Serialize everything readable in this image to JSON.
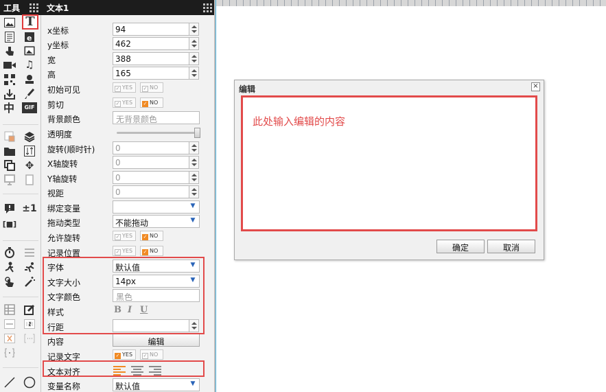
{
  "tools": {
    "title": "工具",
    "items": [
      {
        "name": "image-icon"
      },
      {
        "name": "text-icon",
        "glyph": "T"
      },
      {
        "name": "document-icon"
      },
      {
        "name": "text-box-icon"
      },
      {
        "name": "hand-pointer-icon"
      },
      {
        "name": "picture-icon"
      },
      {
        "name": "video-icon"
      },
      {
        "name": "music-icon"
      },
      {
        "name": "qrcode-icon"
      },
      {
        "name": "stamp-icon"
      },
      {
        "name": "download-icon"
      },
      {
        "name": "brush-icon"
      },
      {
        "name": "chinese-char-icon",
        "glyph": "中"
      },
      {
        "name": "gif-icon",
        "glyph": "GIF"
      },
      {
        "name": "layer-icon"
      },
      {
        "name": "layers-stack-icon"
      },
      {
        "name": "folder-icon"
      },
      {
        "name": "sort-icon"
      },
      {
        "name": "copy-icon"
      },
      {
        "name": "move-icon"
      },
      {
        "name": "monitor-icon"
      },
      {
        "name": "tablet-icon"
      },
      {
        "name": "comment-icon"
      },
      {
        "name": "plus-minus-icon",
        "glyph": "±1"
      },
      {
        "name": "bracket-icon",
        "glyph": "[■]"
      },
      {
        "name": "timer-icon"
      },
      {
        "name": "sliders-icon"
      },
      {
        "name": "figure-icon"
      },
      {
        "name": "running-icon"
      },
      {
        "name": "touch-icon"
      },
      {
        "name": "magic-wand-icon"
      },
      {
        "name": "table-icon"
      },
      {
        "name": "edit-icon"
      },
      {
        "name": "input-icon"
      },
      {
        "name": "number-icon"
      },
      {
        "name": "close-box-icon"
      },
      {
        "name": "dots-box-icon"
      },
      {
        "name": "brace-icon"
      },
      {
        "name": "line-icon"
      },
      {
        "name": "circle-icon"
      }
    ]
  },
  "panel": {
    "title": "文本1",
    "x_label": "x坐标",
    "x_value": "94",
    "y_label": "y坐标",
    "y_value": "462",
    "w_label": "宽",
    "w_value": "388",
    "h_label": "高",
    "h_value": "165",
    "visible_label": "初始可见",
    "clip_label": "剪切",
    "bg_label": "背景颜色",
    "bg_placeholder": "无背景颜色",
    "opacity_label": "透明度",
    "rotate_label": "旋转(顺时针)",
    "rotate_value": "0",
    "xrot_label": "X轴旋转",
    "xrot_value": "0",
    "yrot_label": "Y轴旋转",
    "yrot_value": "0",
    "view_label": "视距",
    "view_value": "0",
    "bindvar_label": "绑定变量",
    "bindvar_value": "",
    "drag_label": "拖动类型",
    "drag_value": "不能拖动",
    "allowrot_label": "允许旋转",
    "recordpos_label": "记录位置",
    "font_label": "字体",
    "font_value": "默认值",
    "fontsize_label": "文字大小",
    "fontsize_value": "14px",
    "fontcolor_label": "文字颜色",
    "fontcolor_value": "黑色",
    "style_label": "样式",
    "style_b": "B",
    "style_i": "I",
    "style_u": "U",
    "linespace_label": "行距",
    "linespace_value": "",
    "content_label": "内容",
    "content_button": "编辑",
    "recordtext_label": "记录文字",
    "align_label": "文本对齐",
    "varname_label": "变量名称",
    "varname_value": "默认值",
    "yes": "YES",
    "no": "NO"
  },
  "dialog": {
    "title": "编辑",
    "close": "×",
    "placeholder": "此处输入编辑的内容",
    "ok": "确定",
    "cancel": "取消"
  },
  "colors": {
    "highlight": "#e24a4a",
    "toggle_on": "#f08a24",
    "titlebar": "#1c1c1c"
  }
}
